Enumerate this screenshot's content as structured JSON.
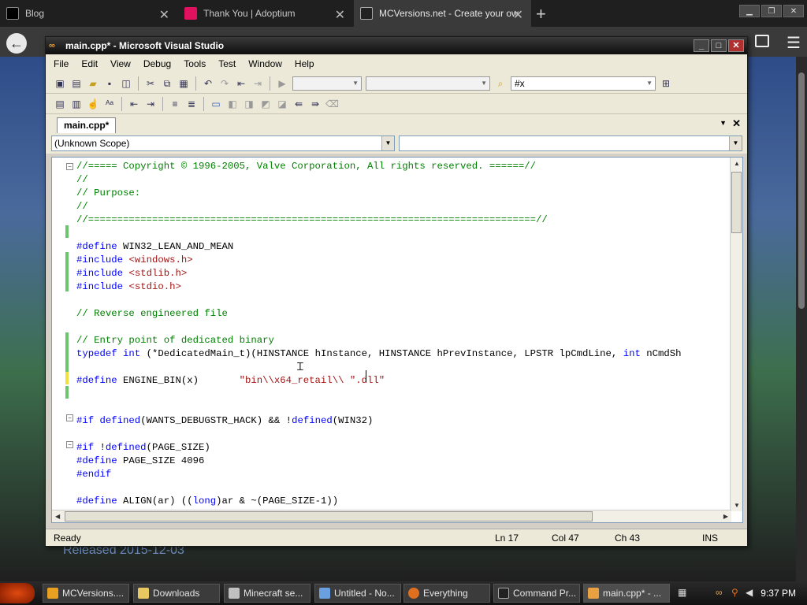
{
  "browser": {
    "tabs": [
      {
        "label": "Blog",
        "fav_color": "#000000"
      },
      {
        "label": "Thank You | Adoptium",
        "fav_color": "#e0115f"
      },
      {
        "label": "MCVersions.net - Create your ow",
        "fav_color": "#222222"
      }
    ],
    "page_text": "Released 2015-12-03"
  },
  "vs": {
    "title": "main.cpp* - Microsoft Visual Studio",
    "menu": [
      "File",
      "Edit",
      "View",
      "Debug",
      "Tools",
      "Test",
      "Window",
      "Help"
    ],
    "find_combo": "#x",
    "doc_tab": "main.cpp*",
    "scope": "(Unknown Scope)",
    "status": {
      "ready": "Ready",
      "line": "Ln 17",
      "col": "Col 47",
      "ch": "Ch 43",
      "mode": "INS"
    }
  },
  "code_lines": [
    [
      {
        "t": "//===== Copyright © 1996-2005, Valve Corporation, All rights reserved. ======//",
        "c": "c"
      }
    ],
    [
      {
        "t": "//",
        "c": "c"
      }
    ],
    [
      {
        "t": "// Purpose:",
        "c": "c"
      }
    ],
    [
      {
        "t": "//",
        "c": "c"
      }
    ],
    [
      {
        "t": "//=============================================================================//",
        "c": "c"
      }
    ],
    [
      {
        "t": "",
        "c": ""
      }
    ],
    [
      {
        "t": "#define",
        "c": "k"
      },
      {
        "t": " WIN32_LEAN_AND_MEAN",
        "c": ""
      }
    ],
    [
      {
        "t": "#include",
        "c": "k"
      },
      {
        "t": " ",
        "c": ""
      },
      {
        "t": "<windows.h>",
        "c": "s"
      }
    ],
    [
      {
        "t": "#include",
        "c": "k"
      },
      {
        "t": " ",
        "c": ""
      },
      {
        "t": "<stdlib.h>",
        "c": "s"
      }
    ],
    [
      {
        "t": "#include",
        "c": "k"
      },
      {
        "t": " ",
        "c": ""
      },
      {
        "t": "<stdio.h>",
        "c": "s"
      }
    ],
    [
      {
        "t": "",
        "c": ""
      }
    ],
    [
      {
        "t": "// Reverse engineered file",
        "c": "c"
      }
    ],
    [
      {
        "t": "",
        "c": ""
      }
    ],
    [
      {
        "t": "// Entry point of dedicated binary",
        "c": "c"
      }
    ],
    [
      {
        "t": "typedef",
        "c": "k"
      },
      {
        "t": " ",
        "c": ""
      },
      {
        "t": "int",
        "c": "k"
      },
      {
        "t": " (*DedicatedMain_t)(HINSTANCE hInstance, HINSTANCE hPrevInstance, LPSTR lpCmdLine, ",
        "c": ""
      },
      {
        "t": "int",
        "c": "k"
      },
      {
        "t": " nCmdSh",
        "c": ""
      }
    ],
    [
      {
        "t": "",
        "c": ""
      }
    ],
    [
      {
        "t": "#define",
        "c": "k"
      },
      {
        "t": " ENGINE_BIN(x)       ",
        "c": ""
      },
      {
        "t": "\"bin\\\\x64_retail\\\\ \".dll\"",
        "c": "s"
      }
    ],
    [
      {
        "t": "",
        "c": ""
      }
    ],
    [
      {
        "t": "",
        "c": ""
      }
    ],
    [
      {
        "t": "#if",
        "c": "k"
      },
      {
        "t": " ",
        "c": ""
      },
      {
        "t": "defined",
        "c": "k"
      },
      {
        "t": "(WANTS_DEBUGSTR_HACK) && !",
        "c": ""
      },
      {
        "t": "defined",
        "c": "k"
      },
      {
        "t": "(WIN32)",
        "c": ""
      }
    ],
    [
      {
        "t": "",
        "c": ""
      }
    ],
    [
      {
        "t": "#if",
        "c": "k"
      },
      {
        "t": " !",
        "c": ""
      },
      {
        "t": "defined",
        "c": "k"
      },
      {
        "t": "(PAGE_SIZE)",
        "c": ""
      }
    ],
    [
      {
        "t": "#define",
        "c": "k"
      },
      {
        "t": " PAGE_SIZE 4096",
        "c": ""
      }
    ],
    [
      {
        "t": "#endif",
        "c": "k"
      }
    ],
    [
      {
        "t": "",
        "c": ""
      }
    ],
    [
      {
        "t": "#define",
        "c": "k"
      },
      {
        "t": " ALIGN(ar) ((",
        "c": ""
      },
      {
        "t": "long",
        "c": "k"
      },
      {
        "t": ")ar & ~(PAGE_SIZE-1))",
        "c": ""
      }
    ]
  ],
  "taskbar": {
    "buttons": [
      {
        "label": "MCVersions....",
        "color": "#e8a020"
      },
      {
        "label": "Downloads",
        "color": "#e8c860"
      },
      {
        "label": "Minecraft se...",
        "color": "#c0c0c0"
      },
      {
        "label": "Untitled - No...",
        "color": "#6aa0e0"
      },
      {
        "label": "Everything",
        "color": "#e07020"
      },
      {
        "label": "Command Pr...",
        "color": "#222222"
      },
      {
        "label": "main.cpp* - ...",
        "color": "#e8a040"
      }
    ],
    "clock": "9:37 PM"
  }
}
